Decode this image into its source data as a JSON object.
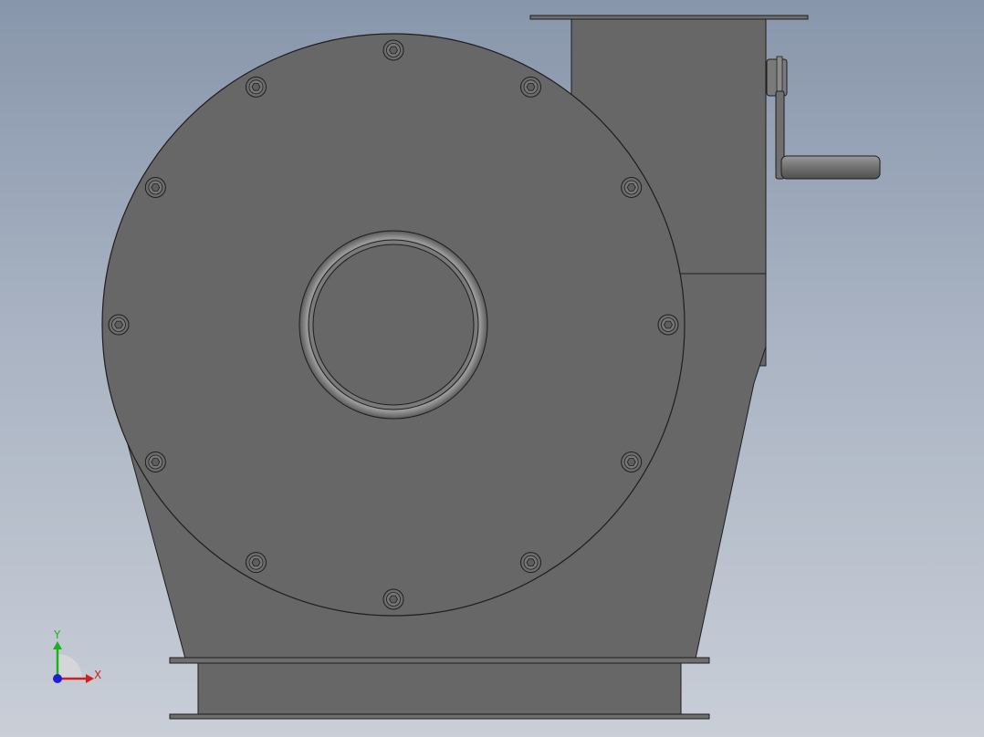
{
  "viewport": {
    "background_top": "#8896ab",
    "background_bottom": "#c9ced7"
  },
  "model": {
    "body_color": "#676767",
    "outline_color": "#1e1e1e",
    "flange_color": "#6e6e6e",
    "bolt_count": 12,
    "bolt_icon": "hex-socket-bolt-icon",
    "handle_icon": "crank-handle-icon"
  },
  "triad": {
    "y_label": "Y",
    "x_label": "X",
    "y_color": "#19b419",
    "x_color": "#d21e1e",
    "z_color": "#1e1ed2"
  }
}
